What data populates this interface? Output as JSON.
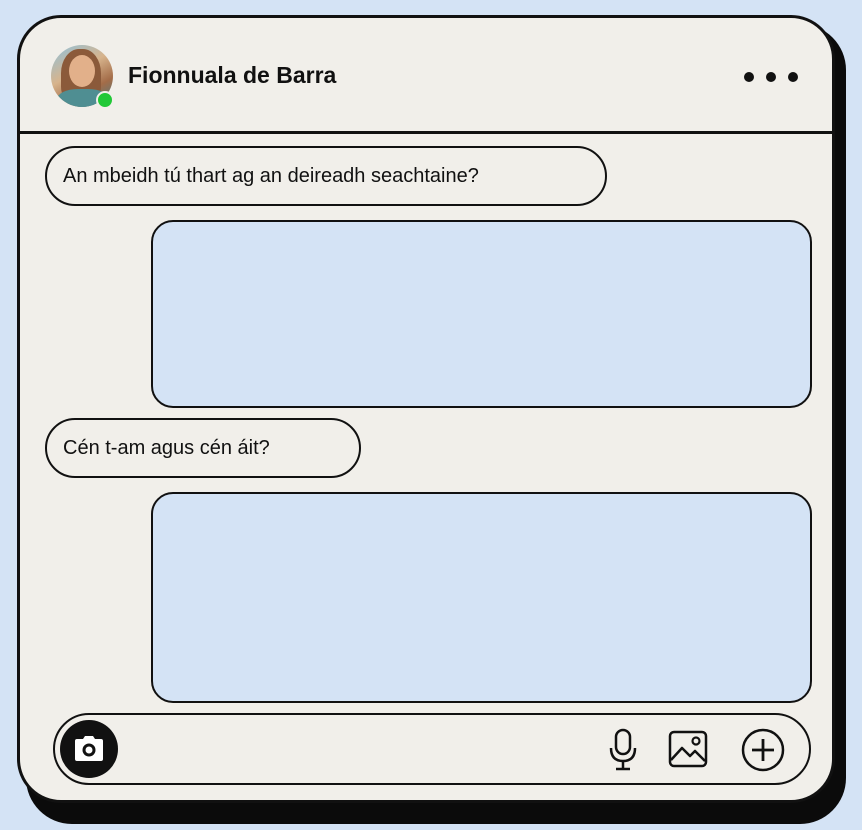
{
  "contact": {
    "name": "Fionnuala de Barra",
    "status_color": "#22c837",
    "avatar_icon": "profile-photo"
  },
  "header": {
    "menu_icon": "more-horizontal-icon"
  },
  "messages": [
    {
      "direction": "incoming",
      "text": "An mbeidh tú thart ag an deireadh seachtaine?"
    },
    {
      "direction": "outgoing",
      "text": ""
    },
    {
      "direction": "incoming",
      "text": "Cén t-am agus cén áit?"
    },
    {
      "direction": "outgoing",
      "text": ""
    }
  ],
  "composer": {
    "camera_icon": "camera-icon",
    "mic_icon": "microphone-icon",
    "image_icon": "image-icon",
    "add_icon": "plus-circle-icon"
  },
  "colors": {
    "page_background": "#d4e3f5",
    "window_background": "#f1efea",
    "outgoing_bubble": "#d4e3f5",
    "outline": "#111111"
  }
}
